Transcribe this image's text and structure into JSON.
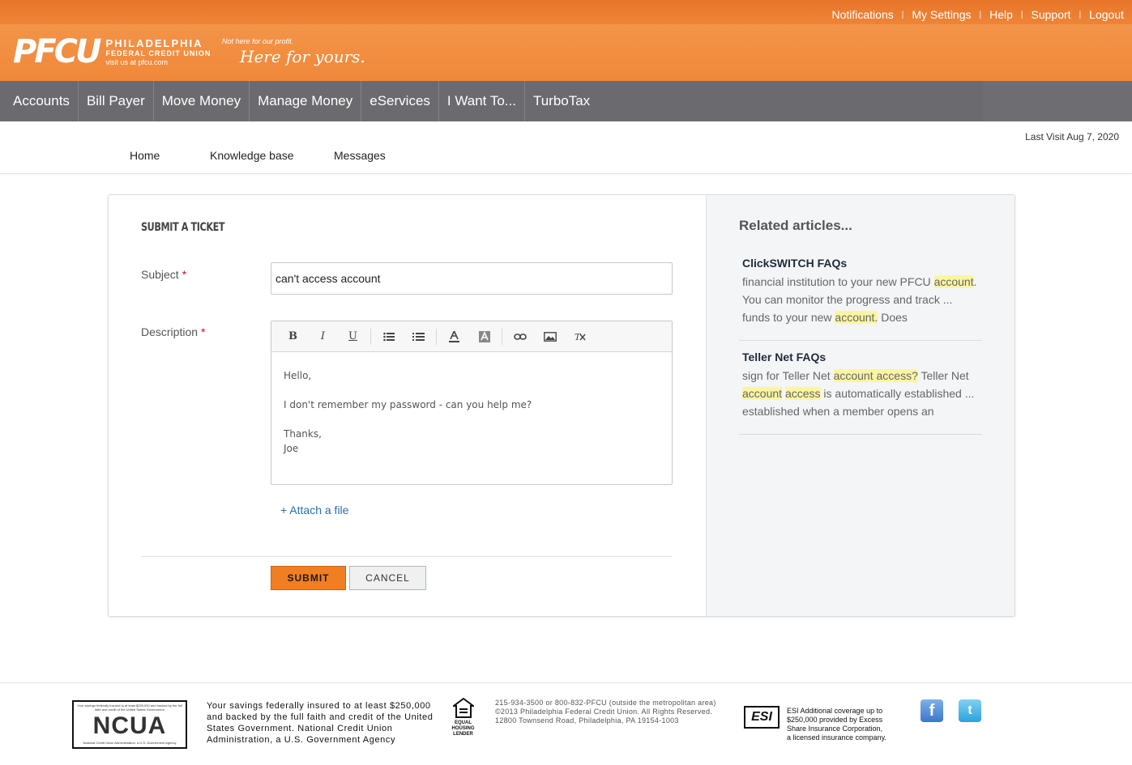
{
  "header": {
    "top_links": [
      "Notifications",
      "My Settings",
      "Help",
      "Support",
      "Logout"
    ],
    "logo": {
      "mark": "PFCU",
      "line1": "PHILADELPHIA",
      "line2": "FEDERAL CREDIT UNION",
      "line3": "visit us at pfcu.com"
    },
    "tagline": {
      "small": "Not here for our profit.",
      "large": "Here for yours."
    }
  },
  "main_nav": [
    "Accounts",
    "Bill Payer",
    "Move Money",
    "Manage Money",
    "eServices",
    "I Want To...",
    "TurboTax"
  ],
  "sub_nav": {
    "last_visit": "Last Visit Aug 7, 2020",
    "links": [
      "Home",
      "Knowledge base",
      "Messages"
    ]
  },
  "form": {
    "title": "SUBMIT A TICKET",
    "subject_label": "Subject",
    "subject_value": "can't access account",
    "description_label": "Description",
    "required_mark": "*",
    "toolbar": {
      "bold": "B",
      "italic": "I",
      "underline": "U",
      "icons": [
        "bulleted-list-icon",
        "numbered-list-icon",
        "text-color-icon",
        "background-color-icon",
        "link-icon",
        "image-icon",
        "clear-format-icon"
      ]
    },
    "body_lines": [
      "Hello,",
      "I don't remember my password - can you help me?",
      "Thanks,",
      "Joe"
    ],
    "attach_label": "+ Attach a file",
    "submit_label": "SUBMIT",
    "cancel_label": "CANCEL"
  },
  "related": {
    "title": "Related articles...",
    "articles": [
      {
        "title": "ClickSWITCH FAQs",
        "line1_pre": "financial institution to your new PFCU ",
        "line1_hl": "account",
        "line1_post": ".",
        "line2": "You can monitor the progress and track ...",
        "line3_pre": "funds to your new ",
        "line3_hl": "account.",
        "line3_post": " Does"
      },
      {
        "title": "Teller Net FAQs",
        "line1_pre": "sign for Teller Net ",
        "line1_hl": "account access?",
        "line1_post": " Teller Net",
        "line2_hl1": "account",
        "line2_mid": " ",
        "line2_hl2": "access",
        "line2_post": " is automatically established ...",
        "line3": "established when a member opens an"
      }
    ]
  },
  "footer": {
    "ncua_top": "Your savings federally insured to at least $250,000 and backed by the full faith and credit of the United States Government",
    "ncua_logo": "NCUA",
    "ncua_bottom": "National Credit Union Administration, a U.S. Government Agency",
    "insured_text": "Your savings federally insured to at least $250,000 and backed by the full faith and credit of the United States Government. National Credit Union Administration, a U.S. Government Agency",
    "ehl_line1": "EQUAL HOUSING",
    "ehl_line2": "LENDER",
    "address_lines": [
      "215-934-3500 or 800-832-PFCU (outside the metropolitan area)",
      "©2013 Philadelphia Federal Credit Union. All Rights Reserved.",
      "12800 Townsend Road, Philadelphia, PA 19154-1003"
    ],
    "esi_logo": "ESI",
    "esi_lines": [
      "ESI Additional coverage up to",
      "$250,000 provided by Excess",
      "Share Insurance Corporation,",
      "a licensed insurance company."
    ],
    "facebook": "f",
    "twitter": "t"
  },
  "colors": {
    "brand_orange": "#f0883a",
    "nav_gray": "#6b6b6f",
    "submit_orange": "#f07f23",
    "link_blue": "#2a6fb0",
    "highlight": "#fbf5a3"
  }
}
